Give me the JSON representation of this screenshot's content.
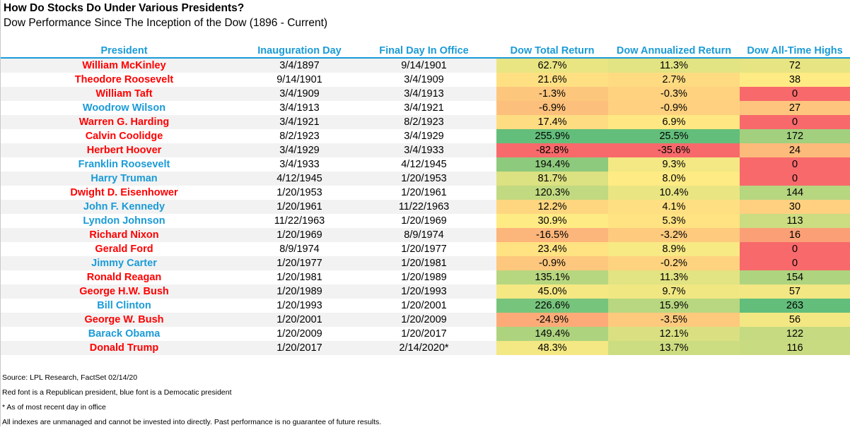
{
  "title": "How Do Stocks Do Under Various Presidents?",
  "subtitle": "Dow Performance Since The Inception of the Dow (1896 - Current)",
  "colors": {
    "header": "#1a9bd7",
    "republican": "#ff0000",
    "democrat": "#1a9bd7",
    "heat_low": "#f8696b",
    "heat_mid": "#ffeb84",
    "heat_high": "#63be7b"
  },
  "chart_data": {
    "type": "table",
    "title": "How Do Stocks Do Under Various Presidents?",
    "subtitle": "Dow Performance Since The Inception of the Dow (1896 - Current)",
    "columns": [
      "President",
      "Inauguration Day",
      "Final Day In Office",
      "Dow Total Return",
      "Dow Annualized Return",
      "Dow All-Time Highs"
    ],
    "heatmap_columns": [
      "Dow Total Return",
      "Dow Annualized Return",
      "Dow All-Time Highs"
    ],
    "rows": [
      {
        "president": "William McKinley",
        "party": "R",
        "inauguration": "3/4/1897",
        "final_day": "9/14/1901",
        "total_return": "62.7%",
        "annualized_return": "11.3%",
        "all_time_highs": "72",
        "total_value": 62.7,
        "annual_value": 11.3,
        "ath_value": 72
      },
      {
        "president": "Theodore Roosevelt",
        "party": "R",
        "inauguration": "9/14/1901",
        "final_day": "3/4/1909",
        "total_return": "21.6%",
        "annualized_return": "2.7%",
        "all_time_highs": "38",
        "total_value": 21.6,
        "annual_value": 2.7,
        "ath_value": 38
      },
      {
        "president": "William Taft",
        "party": "R",
        "inauguration": "3/4/1909",
        "final_day": "3/4/1913",
        "total_return": "-1.3%",
        "annualized_return": "-0.3%",
        "all_time_highs": "0",
        "total_value": -1.3,
        "annual_value": -0.3,
        "ath_value": 0
      },
      {
        "president": "Woodrow Wilson",
        "party": "D",
        "inauguration": "3/4/1913",
        "final_day": "3/4/1921",
        "total_return": "-6.9%",
        "annualized_return": "-0.9%",
        "all_time_highs": "27",
        "total_value": -6.9,
        "annual_value": -0.9,
        "ath_value": 27
      },
      {
        "president": "Warren G. Harding",
        "party": "R",
        "inauguration": "3/4/1921",
        "final_day": "8/2/1923",
        "total_return": "17.4%",
        "annualized_return": "6.9%",
        "all_time_highs": "0",
        "total_value": 17.4,
        "annual_value": 6.9,
        "ath_value": 0
      },
      {
        "president": "Calvin Coolidge",
        "party": "R",
        "inauguration": "8/2/1923",
        "final_day": "3/4/1929",
        "total_return": "255.9%",
        "annualized_return": "25.5%",
        "all_time_highs": "172",
        "total_value": 255.9,
        "annual_value": 25.5,
        "ath_value": 172
      },
      {
        "president": "Herbert Hoover",
        "party": "R",
        "inauguration": "3/4/1929",
        "final_day": "3/4/1933",
        "total_return": "-82.8%",
        "annualized_return": "-35.6%",
        "all_time_highs": "24",
        "total_value": -82.8,
        "annual_value": -35.6,
        "ath_value": 24
      },
      {
        "president": "Franklin Roosevelt",
        "party": "D",
        "inauguration": "3/4/1933",
        "final_day": "4/12/1945",
        "total_return": "194.4%",
        "annualized_return": "9.3%",
        "all_time_highs": "0",
        "total_value": 194.4,
        "annual_value": 9.3,
        "ath_value": 0
      },
      {
        "president": "Harry Truman",
        "party": "D",
        "inauguration": "4/12/1945",
        "final_day": "1/20/1953",
        "total_return": "81.7%",
        "annualized_return": "8.0%",
        "all_time_highs": "0",
        "total_value": 81.7,
        "annual_value": 8.0,
        "ath_value": 0
      },
      {
        "president": "Dwight D. Eisenhower",
        "party": "R",
        "inauguration": "1/20/1953",
        "final_day": "1/20/1961",
        "total_return": "120.3%",
        "annualized_return": "10.4%",
        "all_time_highs": "144",
        "total_value": 120.3,
        "annual_value": 10.4,
        "ath_value": 144
      },
      {
        "president": "John F. Kennedy",
        "party": "D",
        "inauguration": "1/20/1961",
        "final_day": "11/22/1963",
        "total_return": "12.2%",
        "annualized_return": "4.1%",
        "all_time_highs": "30",
        "total_value": 12.2,
        "annual_value": 4.1,
        "ath_value": 30
      },
      {
        "president": "Lyndon Johnson",
        "party": "D",
        "inauguration": "11/22/1963",
        "final_day": "1/20/1969",
        "total_return": "30.9%",
        "annualized_return": "5.3%",
        "all_time_highs": "113",
        "total_value": 30.9,
        "annual_value": 5.3,
        "ath_value": 113
      },
      {
        "president": "Richard Nixon",
        "party": "R",
        "inauguration": "1/20/1969",
        "final_day": "8/9/1974",
        "total_return": "-16.5%",
        "annualized_return": "-3.2%",
        "all_time_highs": "16",
        "total_value": -16.5,
        "annual_value": -3.2,
        "ath_value": 16
      },
      {
        "president": "Gerald Ford",
        "party": "R",
        "inauguration": "8/9/1974",
        "final_day": "1/20/1977",
        "total_return": "23.4%",
        "annualized_return": "8.9%",
        "all_time_highs": "0",
        "total_value": 23.4,
        "annual_value": 8.9,
        "ath_value": 0
      },
      {
        "president": "Jimmy Carter",
        "party": "D",
        "inauguration": "1/20/1977",
        "final_day": "1/20/1981",
        "total_return": "-0.9%",
        "annualized_return": "-0.2%",
        "all_time_highs": "0",
        "total_value": -0.9,
        "annual_value": -0.2,
        "ath_value": 0
      },
      {
        "president": "Ronald Reagan",
        "party": "R",
        "inauguration": "1/20/1981",
        "final_day": "1/20/1989",
        "total_return": "135.1%",
        "annualized_return": "11.3%",
        "all_time_highs": "154",
        "total_value": 135.1,
        "annual_value": 11.3,
        "ath_value": 154
      },
      {
        "president": "George H.W. Bush",
        "party": "R",
        "inauguration": "1/20/1989",
        "final_day": "1/20/1993",
        "total_return": "45.0%",
        "annualized_return": "9.7%",
        "all_time_highs": "57",
        "total_value": 45.0,
        "annual_value": 9.7,
        "ath_value": 57
      },
      {
        "president": "Bill Clinton",
        "party": "D",
        "inauguration": "1/20/1993",
        "final_day": "1/20/2001",
        "total_return": "226.6%",
        "annualized_return": "15.9%",
        "all_time_highs": "263",
        "total_value": 226.6,
        "annual_value": 15.9,
        "ath_value": 263
      },
      {
        "president": "George W. Bush",
        "party": "R",
        "inauguration": "1/20/2001",
        "final_day": "1/20/2009",
        "total_return": "-24.9%",
        "annualized_return": "-3.5%",
        "all_time_highs": "56",
        "total_value": -24.9,
        "annual_value": -3.5,
        "ath_value": 56
      },
      {
        "president": "Barack Obama",
        "party": "D",
        "inauguration": "1/20/2009",
        "final_day": "1/20/2017",
        "total_return": "149.4%",
        "annualized_return": "12.1%",
        "all_time_highs": "122",
        "total_value": 149.4,
        "annual_value": 12.1,
        "ath_value": 122
      },
      {
        "president": "Donald Trump",
        "party": "R",
        "inauguration": "1/20/2017",
        "final_day": "2/14/2020*",
        "total_return": "48.3%",
        "annualized_return": "13.7%",
        "all_time_highs": "116",
        "total_value": 48.3,
        "annual_value": 13.7,
        "ath_value": 116
      }
    ]
  },
  "notes": [
    "Source: LPL Research, FactSet 02/14/20",
    "Red font is a Republican president, blue font is a Democatic president",
    "* As of most recent day in office",
    "All indexes are unmanaged and cannot be invested into directly. Past performance is no guarantee of future results."
  ]
}
